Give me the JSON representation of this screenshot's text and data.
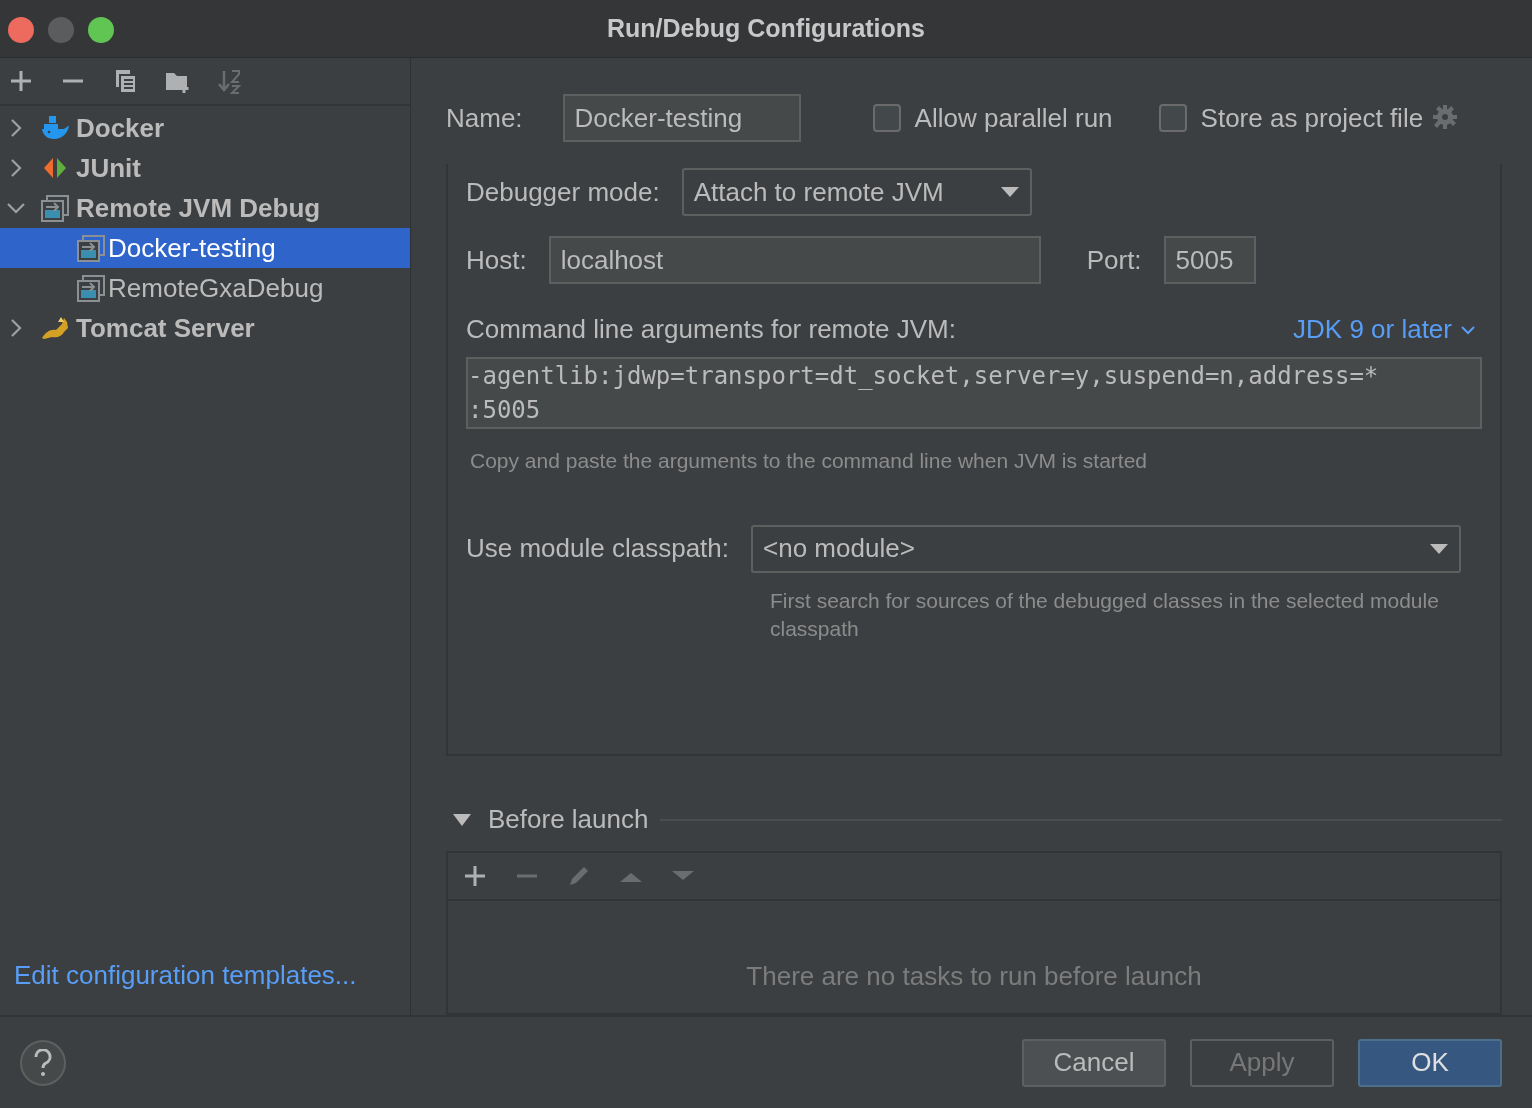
{
  "window": {
    "title": "Run/Debug Configurations"
  },
  "toolbar": [
    {
      "kind": "add",
      "disabled": false
    },
    {
      "kind": "remove",
      "disabled": false
    },
    {
      "kind": "copy",
      "disabled": false
    },
    {
      "kind": "folder",
      "disabled": false
    },
    {
      "kind": "sort",
      "disabled": true
    }
  ],
  "tree": [
    {
      "label": "Docker",
      "kind": "docker",
      "expanded": false,
      "selected": false
    },
    {
      "label": "JUnit",
      "kind": "junit",
      "expanded": false,
      "selected": false
    },
    {
      "label": "Remote JVM Debug",
      "kind": "remote",
      "expanded": true,
      "selected": false,
      "children": [
        {
          "label": "Docker-testing",
          "kind": "remote",
          "selected": true
        },
        {
          "label": "RemoteGxaDebug",
          "kind": "remote",
          "selected": false
        }
      ]
    },
    {
      "label": "Tomcat Server",
      "kind": "tomcat",
      "expanded": false,
      "selected": false
    }
  ],
  "templates_link": "Edit configuration templates...",
  "name": {
    "label": "Name:",
    "value": "Docker-testing"
  },
  "options": [
    {
      "label": "Allow parallel run",
      "checked": false
    },
    {
      "label": "Store as project file",
      "checked": false
    }
  ],
  "debugger_mode": {
    "label": "Debugger mode:",
    "value": "Attach to remote JVM"
  },
  "host": {
    "label": "Host:",
    "value": "localhost"
  },
  "port": {
    "label": "Port:",
    "value": "5005"
  },
  "arguments": {
    "label": "Command line arguments for remote JVM:",
    "jdk_link": "JDK 9 or later",
    "lines": [
      "-agentlib:jdwp=transport=dt_socket,server=y,suspend=n,address=*",
      ":5005"
    ],
    "hint": "Copy and paste the arguments to the command line when JVM is started"
  },
  "module": {
    "label": "Use module classpath:",
    "value": "<no module>",
    "hint": "First search for sources of the debugged classes in the selected module classpath"
  },
  "before_launch": {
    "title": "Before launch",
    "expanded": true,
    "toolbar": [
      {
        "kind": "add",
        "disabled": false
      },
      {
        "kind": "remove",
        "disabled": true
      },
      {
        "kind": "edit",
        "disabled": true
      },
      {
        "kind": "up",
        "disabled": true
      },
      {
        "kind": "down",
        "disabled": true
      }
    ],
    "empty_text": "There are no tasks to run before launch"
  },
  "buttons": [
    {
      "label": "Cancel",
      "disabled": false,
      "default": false
    },
    {
      "label": "Apply",
      "disabled": true,
      "default": false
    },
    {
      "label": "OK",
      "disabled": false,
      "default": true
    }
  ]
}
